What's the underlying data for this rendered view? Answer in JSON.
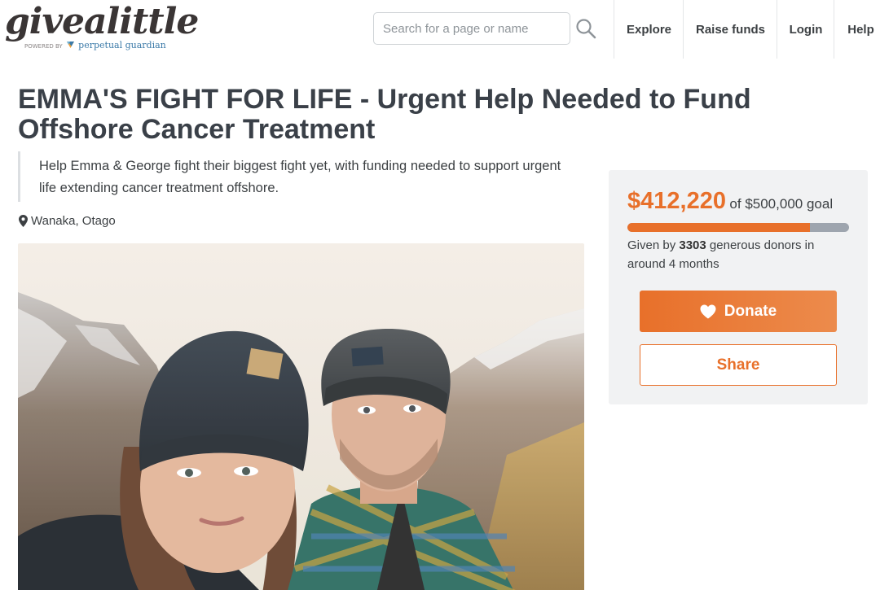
{
  "brand": {
    "logo_text": "givealittle",
    "powered_by": "POWERED BY",
    "partner_name": "perpetual guardian",
    "accent_color": "#e8702a"
  },
  "search": {
    "placeholder": "Search for a page or name",
    "icon": "search-icon"
  },
  "nav": {
    "explore": "Explore",
    "raise_funds": "Raise funds",
    "login": "Login",
    "help": "Help"
  },
  "page": {
    "title": "EMMA'S FIGHT FOR LIFE - Urgent Help Needed to Fund Offshore Cancer Treatment",
    "summary": "Help Emma & George fight their biggest fight yet, with funding needed to support urgent life extending cancer treatment offshore.",
    "location": "Wanaka, Otago",
    "location_icon": "map-pin-icon",
    "hero_image": "photo-couple-selfie-mountains"
  },
  "donation": {
    "amount_raised": "$412,220",
    "goal_text": "of $500,000 goal",
    "progress_fraction": 0.824,
    "donors_prefix": "Given by",
    "donor_count": "3303",
    "donors_suffix": "generous donors in around 4 months",
    "donate_label": "Donate",
    "donate_icon": "heart-icon",
    "share_label": "Share"
  }
}
